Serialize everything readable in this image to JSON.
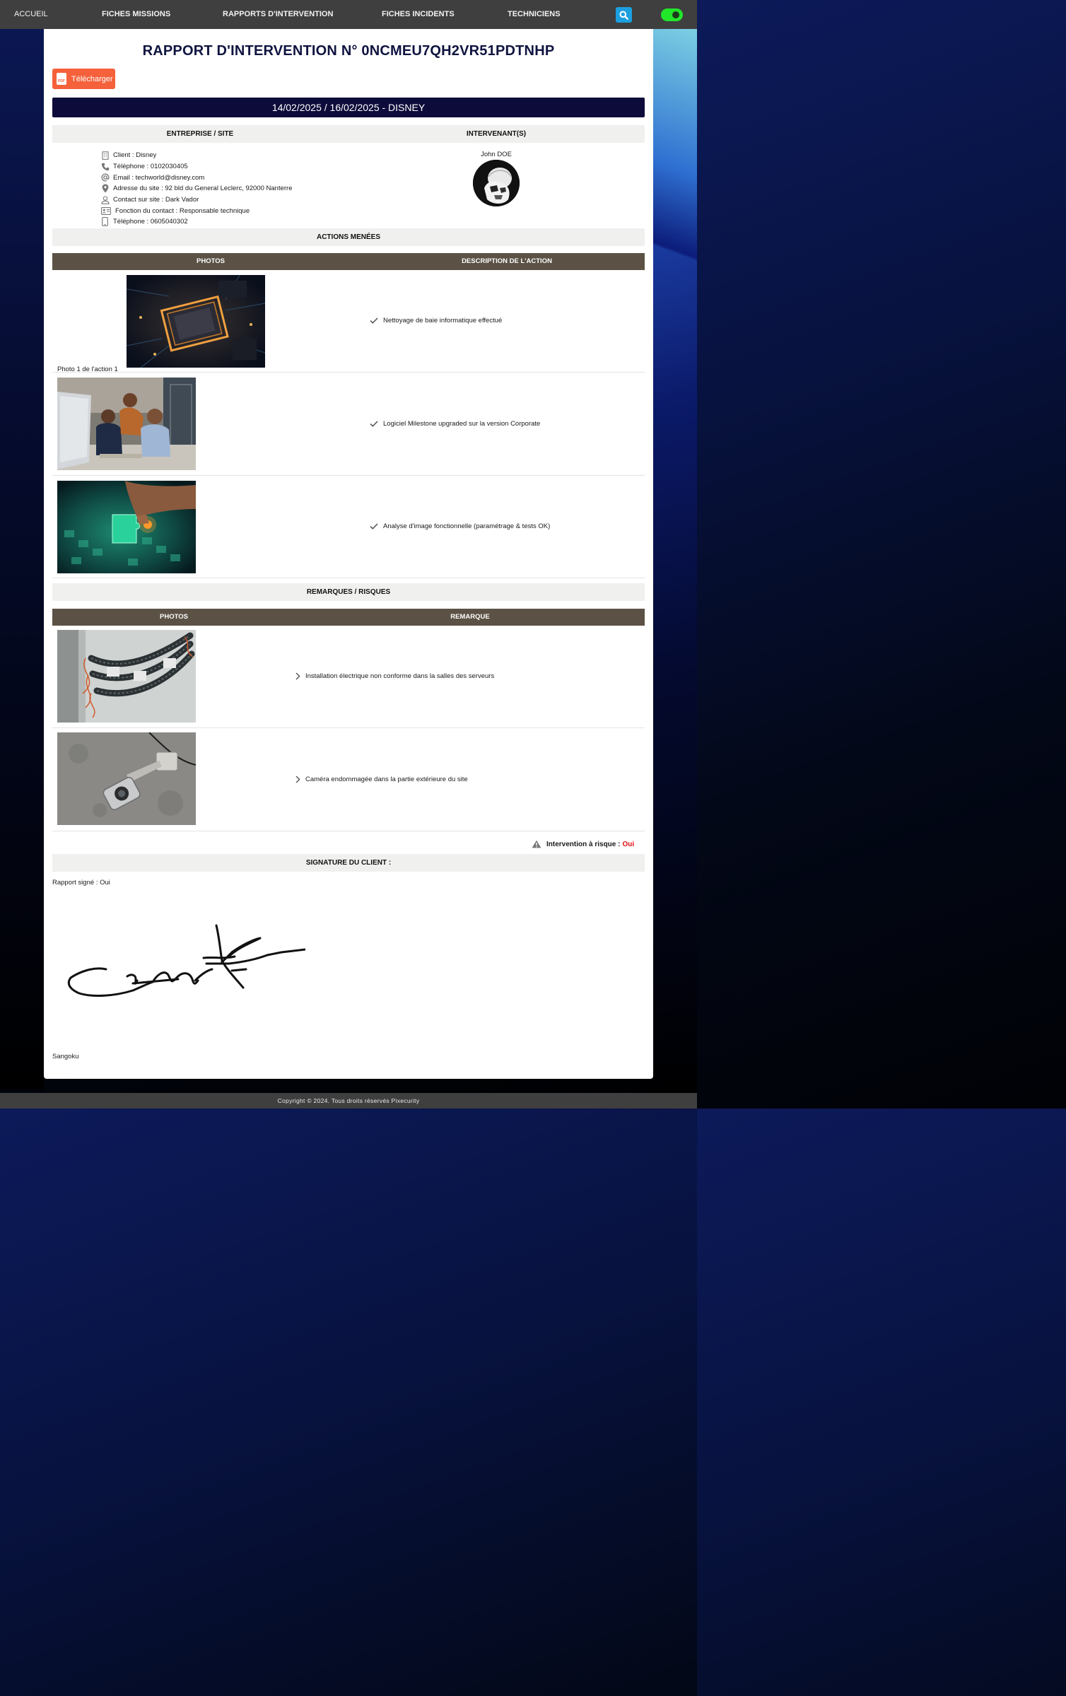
{
  "nav": {
    "home": "ACCUEIL",
    "items": [
      "FICHES MISSIONS",
      "RAPPORTS D'INTERVENTION",
      "FICHES INCIDENTS",
      "TECHNICIENS"
    ],
    "search_icon": "search-icon",
    "toggle_color": "#22e62a"
  },
  "report": {
    "title": "RAPPORT D'INTERVENTION N° 0NCMEU7QH2VR51PDTNHP",
    "download_label": "Télécharger",
    "download_icon": "pdf-icon",
    "pdf_badge": "PDF",
    "date_bar": "14/02/2025 / 16/02/2025 - DISNEY"
  },
  "company": {
    "heading": "ENTREPRISE / SITE",
    "rows": [
      {
        "icon": "building-icon",
        "text": "Client : Disney"
      },
      {
        "icon": "phone-icon",
        "text": "Téléphone : 0102030405"
      },
      {
        "icon": "at-icon",
        "text": "Email : techworld@disney.com"
      },
      {
        "icon": "map-pin-icon",
        "text": "Adresse du site : 92 bld du General Leclerc, 92000 Nanterre"
      },
      {
        "icon": "user-icon",
        "text": "Contact sur site : Dark Vador"
      },
      {
        "icon": "id-card-icon",
        "text": "Fonction du contact : Responsable technique"
      },
      {
        "icon": "mobile-icon",
        "text": "Téléphone : 0605040302"
      }
    ]
  },
  "technician": {
    "heading": "INTERVENANT(S)",
    "name": "John DOE"
  },
  "actions": {
    "heading": "ACTIONS MENÉES",
    "col_photos": "PHOTOS",
    "col_desc": "DESCRIPTION DE L'ACTION",
    "caption": "Photo 1 de l'action 1",
    "items": [
      {
        "text": "Nettoyage de baie informatique effectué"
      },
      {
        "text": "Logiciel Milestone upgraded sur la version Corporate"
      },
      {
        "text": "Analyse d'image fonctionnelle (paramétrage & tests OK)"
      }
    ]
  },
  "remarks": {
    "heading": "REMARQUES / RISQUES",
    "col_photos": "PHOTOS",
    "col_remark": "REMARQUE",
    "items": [
      {
        "text": "Installation électrique non conforme dans la salles des serveurs"
      },
      {
        "text": "Caméra endommagée dans la partie extérieure du site"
      }
    ]
  },
  "risk": {
    "label": "Intervention à risque :",
    "value": "Oui",
    "value_color": "#e01010"
  },
  "signature": {
    "heading": "SIGNATURE DU CLIENT :",
    "signed": "Rapport signé : Oui",
    "signer": "Sangoku"
  },
  "footer": {
    "text": "Copyright © 2024. Tous droits réservés Pixecurity"
  }
}
